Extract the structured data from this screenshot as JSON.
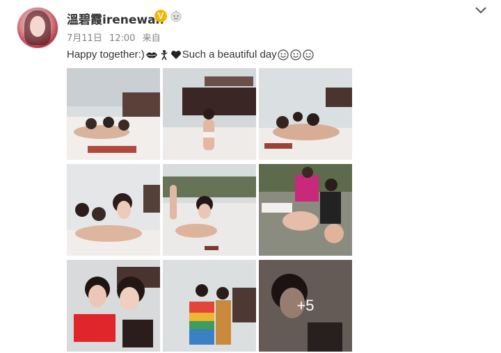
{
  "post": {
    "username": "溫碧霞irenewan",
    "verified_badge": "V",
    "date": "7月11日",
    "time": "12:00",
    "source": "来自",
    "text_part1": "Happy together:)",
    "text_part2": "Such a beautiful day",
    "more_photos_label": "+5"
  },
  "icons": {
    "avatar": "avatar-photo",
    "verified": "verified-v-icon",
    "rank": "member-rank-icon",
    "lips": "lips-emoji-icon",
    "dancer": "dancer-emoji-icon",
    "heart": "heart-icon",
    "smiley": "smiley-emoji-icon",
    "menu": "chevron-down-icon"
  },
  "colors": {
    "verified_badge": "#f7b500",
    "text": "#333333",
    "meta": "#808080"
  }
}
